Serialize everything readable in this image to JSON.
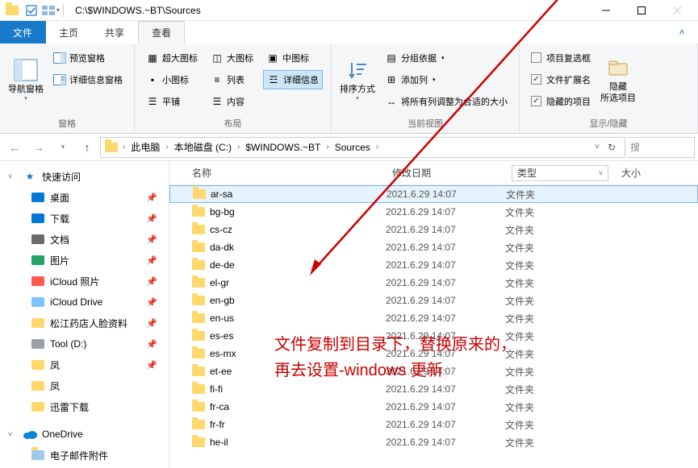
{
  "title_path": "C:\\$WINDOWS.~BT\\Sources",
  "tabs": {
    "file": "文件",
    "home": "主页",
    "share": "共享",
    "view": "查看"
  },
  "ribbon": {
    "panes": {
      "label": "窗格",
      "nav": "导航窗格",
      "preview": "预览窗格",
      "details": "详细信息窗格"
    },
    "layout": {
      "label": "布局",
      "xlarge": "超大图标",
      "large": "大图标",
      "medium": "中图标",
      "small": "小图标",
      "list": "列表",
      "details": "详细信息",
      "tiles": "平铺",
      "content": "内容"
    },
    "current": {
      "label": "当前视图",
      "sort": "排序方式",
      "groupby": "分组依据",
      "addcol": "添加列",
      "fitcols": "将所有列调整为合适的大小"
    },
    "showhide": {
      "label": "显示/隐藏",
      "checkboxes": "项目复选框",
      "ext": "文件扩展名",
      "hiddenitems": "隐藏的项目",
      "hide": "隐藏\n所选项目"
    }
  },
  "breadcrumb": [
    "此电脑",
    "本地磁盘 (C:)",
    "$WINDOWS.~BT",
    "Sources"
  ],
  "search_placeholder": "搜",
  "columns": {
    "name": "名称",
    "date": "修改日期",
    "type": "类型",
    "size": "大小"
  },
  "nav": {
    "quick": "快速访问",
    "items": [
      {
        "label": "桌面",
        "color": "#0078d7",
        "pin": true
      },
      {
        "label": "下载",
        "color": "#0078d7",
        "pin": true
      },
      {
        "label": "文档",
        "color": "#6b6b6b",
        "pin": true
      },
      {
        "label": "图片",
        "color": "#21a366",
        "pin": true
      },
      {
        "label": "iCloud 照片",
        "color": "#ff5b4d",
        "pin": true
      },
      {
        "label": "iCloud Drive",
        "color": "#7cc3ff",
        "pin": true
      },
      {
        "label": "松江药店人脸资料",
        "color": "#ffd86b",
        "pin": true
      },
      {
        "label": "Tool (D:)",
        "color": "#9aa0a6",
        "pin": true
      },
      {
        "label": "凤",
        "color": "#ffd86b",
        "pin": true
      },
      {
        "label": "凤",
        "color": "#ffd86b",
        "pin": false
      },
      {
        "label": "迅雷下载",
        "color": "#ffd86b",
        "pin": false
      }
    ],
    "onedrive": "OneDrive",
    "mailatt": "电子邮件附件"
  },
  "files": [
    {
      "name": "ar-sa",
      "date": "2021.6.29 14:07",
      "type": "文件夹",
      "selected": true
    },
    {
      "name": "bg-bg",
      "date": "2021.6.29 14:07",
      "type": "文件夹"
    },
    {
      "name": "cs-cz",
      "date": "2021.6.29 14:07",
      "type": "文件夹"
    },
    {
      "name": "da-dk",
      "date": "2021.6.29 14:07",
      "type": "文件夹"
    },
    {
      "name": "de-de",
      "date": "2021.6.29 14:07",
      "type": "文件夹"
    },
    {
      "name": "el-gr",
      "date": "2021.6.29 14:07",
      "type": "文件夹"
    },
    {
      "name": "en-gb",
      "date": "2021.6.29 14:07",
      "type": "文件夹"
    },
    {
      "name": "en-us",
      "date": "2021.6.29 14:07",
      "type": "文件夹"
    },
    {
      "name": "es-es",
      "date": "2021.6.29 14:07",
      "type": "文件夹"
    },
    {
      "name": "es-mx",
      "date": "2021.6.29 14:07",
      "type": "文件夹"
    },
    {
      "name": "et-ee",
      "date": "2021.6.29 14:07",
      "type": "文件夹"
    },
    {
      "name": "fi-fi",
      "date": "2021.6.29 14:07",
      "type": "文件夹"
    },
    {
      "name": "fr-ca",
      "date": "2021.6.29 14:07",
      "type": "文件夹"
    },
    {
      "name": "fr-fr",
      "date": "2021.6.29 14:07",
      "type": "文件夹"
    },
    {
      "name": "he-il",
      "date": "2021.6.29 14:07",
      "type": "文件夹"
    }
  ],
  "annotation": {
    "line1": "文件复制到目录下，替换原来的，",
    "line2": "再去设置-windows 更新"
  }
}
